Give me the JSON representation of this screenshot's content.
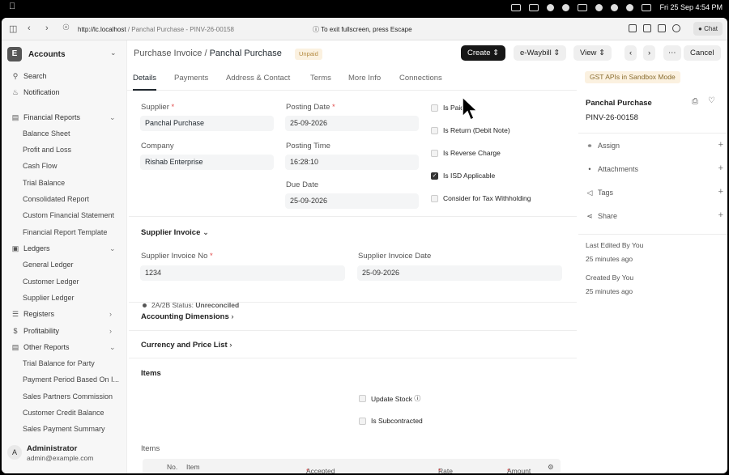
{
  "os": {
    "clock": "Fri 25 Sep  4:54 PM"
  },
  "browser": {
    "url_host": "http://lc.localhost",
    "url_path": " / Panchal Purchase - PINV-26-00158",
    "fullscreen_hint": "To exit fullscreen, press Escape",
    "chat_label": "Chat"
  },
  "sidebar": {
    "app_letter": "E",
    "app_name": "Accounts",
    "items": [
      {
        "label": "Search",
        "icon": "search-icon"
      },
      {
        "label": "Notification",
        "icon": "bell-icon"
      },
      {
        "label": "Financial Reports",
        "icon": "report-icon"
      },
      {
        "label": "Balance Sheet"
      },
      {
        "label": "Profit and Loss"
      },
      {
        "label": "Cash Flow"
      },
      {
        "label": "Trial Balance"
      },
      {
        "label": "Consolidated Report"
      },
      {
        "label": "Custom Financial Statement"
      },
      {
        "label": "Financial Report Template"
      },
      {
        "label": "Ledgers",
        "icon": "ledger-icon"
      },
      {
        "label": "General Ledger"
      },
      {
        "label": "Customer Ledger"
      },
      {
        "label": "Supplier Ledger"
      },
      {
        "label": "Registers",
        "icon": "list-icon"
      },
      {
        "label": "Profitability",
        "icon": "dollar-icon"
      },
      {
        "label": "Other Reports",
        "icon": "report-icon"
      },
      {
        "label": "Trial Balance for Party"
      },
      {
        "label": "Payment Period Based On I..."
      },
      {
        "label": "Sales Partners Commission"
      },
      {
        "label": "Customer Credit Balance"
      },
      {
        "label": "Sales Payment Summary"
      }
    ],
    "user": {
      "initial": "A",
      "name": "Administrator",
      "email": "admin@example.com"
    }
  },
  "header": {
    "doctype": "Purchase Invoice",
    "separator": " / ",
    "title": "Panchal Purchase",
    "status_badge": "Unpaid",
    "create_label": "Create",
    "ewaybill_label": "e-Waybill",
    "view_label": "View",
    "cancel_label": "Cancel"
  },
  "tabs": [
    "Details",
    "Payments",
    "Address & Contact",
    "Terms",
    "More Info",
    "Connections"
  ],
  "form": {
    "supplier_label": "Supplier",
    "supplier_value": "Panchal Purchase",
    "company_label": "Company",
    "company_value": "Rishab Enterprise",
    "posting_date_label": "Posting Date",
    "posting_date_value": "25-09-2026",
    "posting_time_label": "Posting Time",
    "posting_time_value": "16:28:10",
    "due_date_label": "Due Date",
    "due_date_value": "25-09-2026",
    "required_mark": "*",
    "checks": [
      {
        "label": "Is Paid",
        "checked": false
      },
      {
        "label": "Is Return (Debit Note)",
        "checked": false
      },
      {
        "label": "Is Reverse Charge",
        "checked": false
      },
      {
        "label": "Is ISD Applicable",
        "checked": true
      },
      {
        "label": "Consider for Tax Withholding",
        "checked": false
      }
    ],
    "supplier_invoice_section": "Supplier Invoice",
    "supplier_invoice_no_label": "Supplier Invoice No",
    "supplier_invoice_no_value": "1234",
    "supplier_invoice_date_label": "Supplier Invoice Date",
    "supplier_invoice_date_value": "25-09-2026",
    "status_prefix": "2A/2B Status:",
    "status_value": "Unreconciled",
    "accounting_dimensions": "Accounting Dimensions",
    "currency_price_list": "Currency and Price List",
    "items_section": "Items",
    "update_stock": "Update Stock",
    "is_subcontracted": "Is Subcontracted",
    "items_table_label": "Items",
    "table_headers": [
      "No.",
      "Item",
      "Accepted Qty",
      "Rate",
      "Amount"
    ]
  },
  "right_panel": {
    "gst_badge": "GST APIs in Sandbox Mode",
    "title": "Panchal Purchase",
    "doc_id": "PINV-26-00158",
    "actions": [
      "Assign",
      "Attachments",
      "Tags",
      "Share"
    ],
    "last_edited": "Last Edited By You",
    "last_edited_time": "25 minutes ago",
    "created": "Created By You",
    "created_time": "25 minutes ago"
  }
}
